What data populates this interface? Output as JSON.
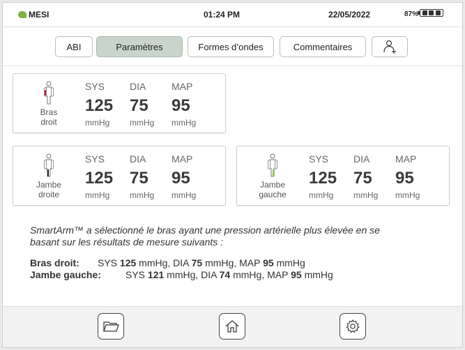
{
  "status": {
    "brand": "MESI",
    "time": "01:24 PM",
    "date": "22/05/2022",
    "battery": "87%"
  },
  "tabs": [
    {
      "label": "ABI",
      "active": false
    },
    {
      "label": "Paramètres",
      "active": true
    },
    {
      "label": "Formes d’ondes",
      "active": false
    },
    {
      "label": "Commentaires",
      "active": false
    }
  ],
  "add_patient_icon": "person-add-icon",
  "cards": {
    "right_arm": {
      "limb": "Bras\ndroit",
      "sys_label": "SYS",
      "dia_label": "DIA",
      "map_label": "MAP",
      "sys": "125",
      "dia": "75",
      "map": "95",
      "unit": "mmHg",
      "highlight_color": "#c62828"
    },
    "right_leg": {
      "limb": "Jambe\ndroite",
      "sys_label": "SYS",
      "dia_label": "DIA",
      "map_label": "MAP",
      "sys": "125",
      "dia": "75",
      "map": "95",
      "unit": "mmHg",
      "highlight_color": "#212121"
    },
    "left_leg": {
      "limb": "Jambe\ngauche",
      "sys_label": "SYS",
      "dia_label": "DIA",
      "map_label": "MAP",
      "sys": "125",
      "dia": "75",
      "map": "95",
      "unit": "mmHg",
      "highlight_color": "#8bc34a"
    }
  },
  "info": {
    "note_line1": "SmartArm™ a sélectionné le bras ayant une pression artérielle plus élevée en se",
    "note_line2": "basant sur les résultats de mesure suivants :",
    "arm_label": "Bras droit:",
    "arm_sys_prefix": "SYS",
    "arm_sys": "125",
    "arm_dia": "75",
    "arm_map": "95",
    "leg_label": "Jambe gauche:",
    "leg_sys": "121",
    "leg_dia": "74",
    "leg_map": "95",
    "unit": "mmHg",
    "dia_prefix": "DIA",
    "map_prefix": "MAP"
  },
  "bottom_nav": [
    "folder-icon",
    "home-icon",
    "settings-icon"
  ],
  "colors": {
    "accent_active_tab": "#c9d5cc",
    "brand": "#7cb342"
  }
}
